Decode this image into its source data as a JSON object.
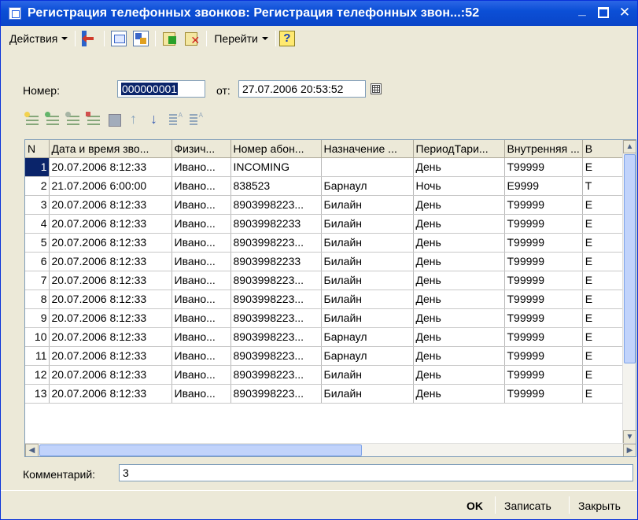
{
  "window": {
    "title": "Регистрация телефонных звонков: Регистрация телефонных звон...:52"
  },
  "toolbar": {
    "actions_label": "Действия",
    "goto_label": "Перейти",
    "help_label": "?"
  },
  "header": {
    "number_label": "Номер:",
    "number_value": "000000001",
    "date_label": "от:",
    "date_value": "27.07.2006 20:53:52"
  },
  "table": {
    "columns": [
      "N",
      "Дата и время зво...",
      "Физич...",
      "Номер абон...",
      "Назначение ...",
      "ПериодТари...",
      "Внутренняя ...",
      "В"
    ],
    "rows": [
      [
        "1",
        "20.07.2006 8:12:33",
        "Ивано...",
        "INCOMING",
        "",
        "День",
        "T99999",
        "E"
      ],
      [
        "2",
        "21.07.2006 6:00:00",
        "Ивано...",
        "838523",
        "Барнаул",
        "Ночь",
        "E9999",
        "T"
      ],
      [
        "3",
        "20.07.2006 8:12:33",
        "Ивано...",
        "8903998223...",
        "Билайн",
        "День",
        "T99999",
        "E"
      ],
      [
        "4",
        "20.07.2006 8:12:33",
        "Ивано...",
        "89039982233",
        "Билайн",
        "День",
        "T99999",
        "E"
      ],
      [
        "5",
        "20.07.2006 8:12:33",
        "Ивано...",
        "8903998223...",
        "Билайн",
        "День",
        "T99999",
        "E"
      ],
      [
        "6",
        "20.07.2006 8:12:33",
        "Ивано...",
        "89039982233",
        "Билайн",
        "День",
        "T99999",
        "E"
      ],
      [
        "7",
        "20.07.2006 8:12:33",
        "Ивано...",
        "8903998223...",
        "Билайн",
        "День",
        "T99999",
        "E"
      ],
      [
        "8",
        "20.07.2006 8:12:33",
        "Ивано...",
        "8903998223...",
        "Билайн",
        "День",
        "T99999",
        "E"
      ],
      [
        "9",
        "20.07.2006 8:12:33",
        "Ивано...",
        "8903998223...",
        "Билайн",
        "День",
        "T99999",
        "E"
      ],
      [
        "10",
        "20.07.2006 8:12:33",
        "Ивано...",
        "8903998223...",
        "Барнаул",
        "День",
        "T99999",
        "E"
      ],
      [
        "11",
        "20.07.2006 8:12:33",
        "Ивано...",
        "8903998223...",
        "Барнаул",
        "День",
        "T99999",
        "E"
      ],
      [
        "12",
        "20.07.2006 8:12:33",
        "Ивано...",
        "8903998223...",
        "Билайн",
        "День",
        "T99999",
        "E"
      ],
      [
        "13",
        "20.07.2006 8:12:33",
        "Ивано...",
        "8903998223...",
        "Билайн",
        "День",
        "T99999",
        "E"
      ]
    ]
  },
  "comment": {
    "label": "Комментарий:",
    "value": "3"
  },
  "footer": {
    "ok_label": "OK",
    "save_label": "Записать",
    "close_label": "Закрыть"
  },
  "colors": {
    "titlebar": "#0b4fd6",
    "selection": "#0a246a",
    "window_bg": "#ece9d8"
  }
}
